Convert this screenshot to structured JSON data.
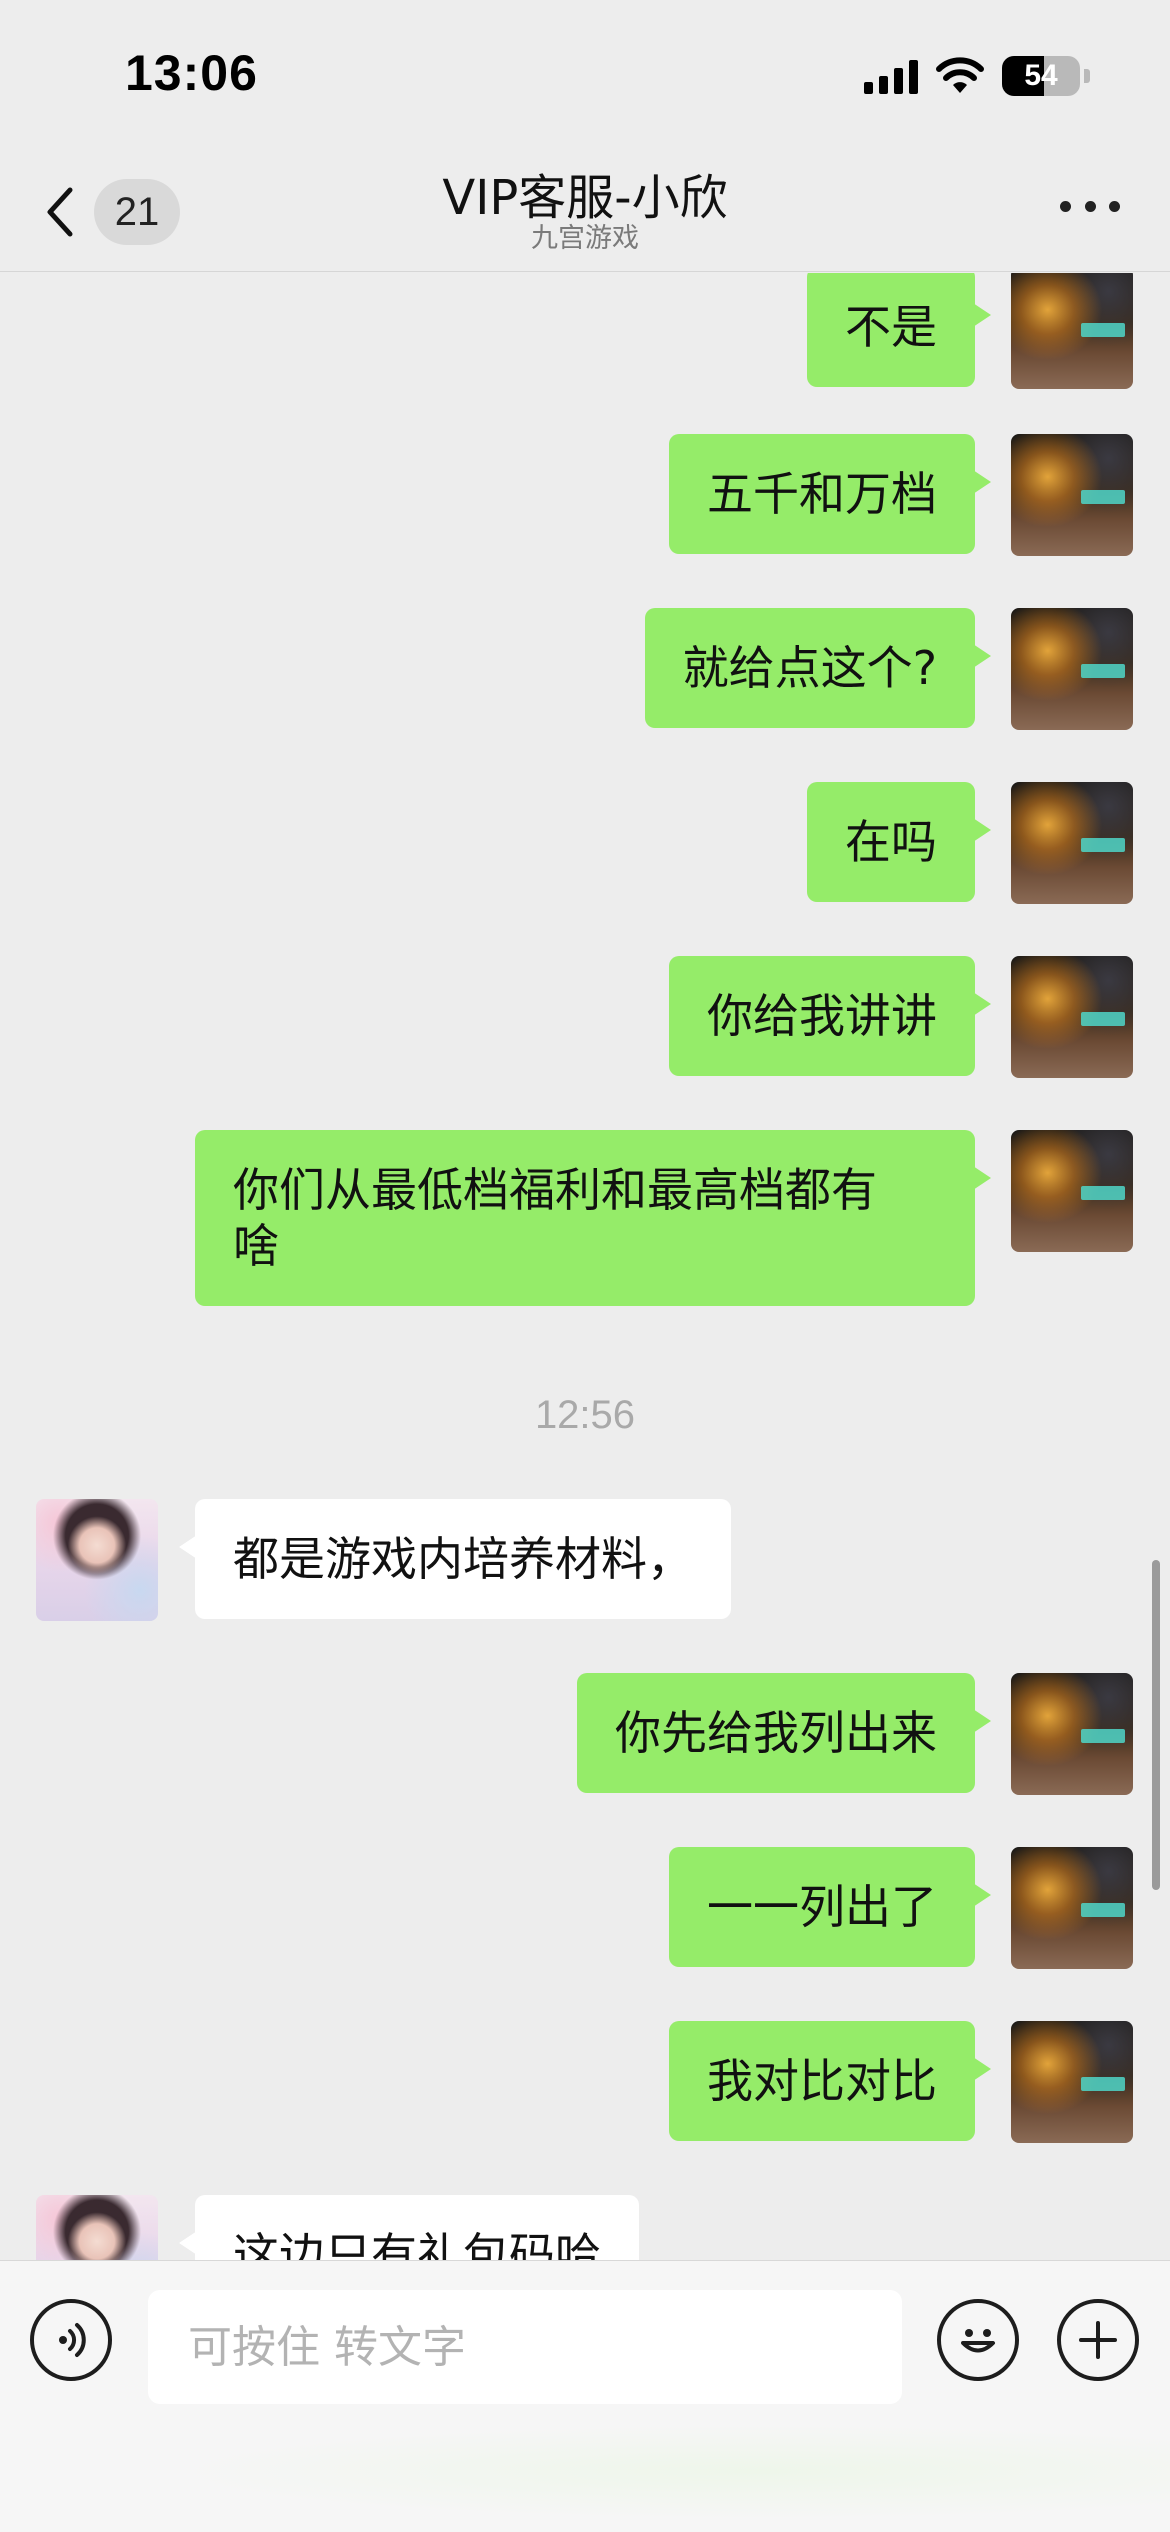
{
  "status_bar": {
    "time": "13:06",
    "battery": "54"
  },
  "header": {
    "unread_count": "21",
    "title": "VIP客服-小欣",
    "subtitle": "九宫游戏"
  },
  "messages": [
    {
      "sender": "me",
      "text": "不是"
    },
    {
      "sender": "me",
      "text": "五千和万档"
    },
    {
      "sender": "me",
      "text": "就给点这个?"
    },
    {
      "sender": "me",
      "text": "在吗"
    },
    {
      "sender": "me",
      "text": "你给我讲讲"
    },
    {
      "sender": "me",
      "text": "你们从最低档福利和最高档都有\n啥"
    },
    {
      "timestamp": "12:56"
    },
    {
      "sender": "her",
      "text": "都是游戏内培养材料，"
    },
    {
      "sender": "me",
      "text": "你先给我列出来"
    },
    {
      "sender": "me",
      "text": "一一列出了"
    },
    {
      "sender": "me",
      "text": "我对比对比"
    },
    {
      "sender": "her",
      "text": "这边只有礼包码哈"
    }
  ],
  "input": {
    "placeholder": "可按住 转文字",
    "value": ""
  },
  "icons": {
    "voice": "voice-icon",
    "emoji": "emoji-icon",
    "plus": "plus-icon",
    "back": "chevron-left-icon",
    "more": "more-dots-icon"
  },
  "colors": {
    "sent_bubble": "#95ec69",
    "received_bubble": "#ffffff",
    "background": "#ededed"
  }
}
